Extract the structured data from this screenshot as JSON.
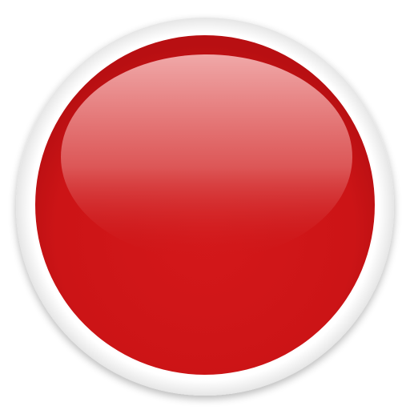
{
  "icon": {
    "name": "red-record-button-icon",
    "colors": {
      "base_red": "#cc1416",
      "highlight_top": "#f0a8a8",
      "highlight_mid": "#dd5a5a",
      "rim": "#ffffff"
    }
  }
}
